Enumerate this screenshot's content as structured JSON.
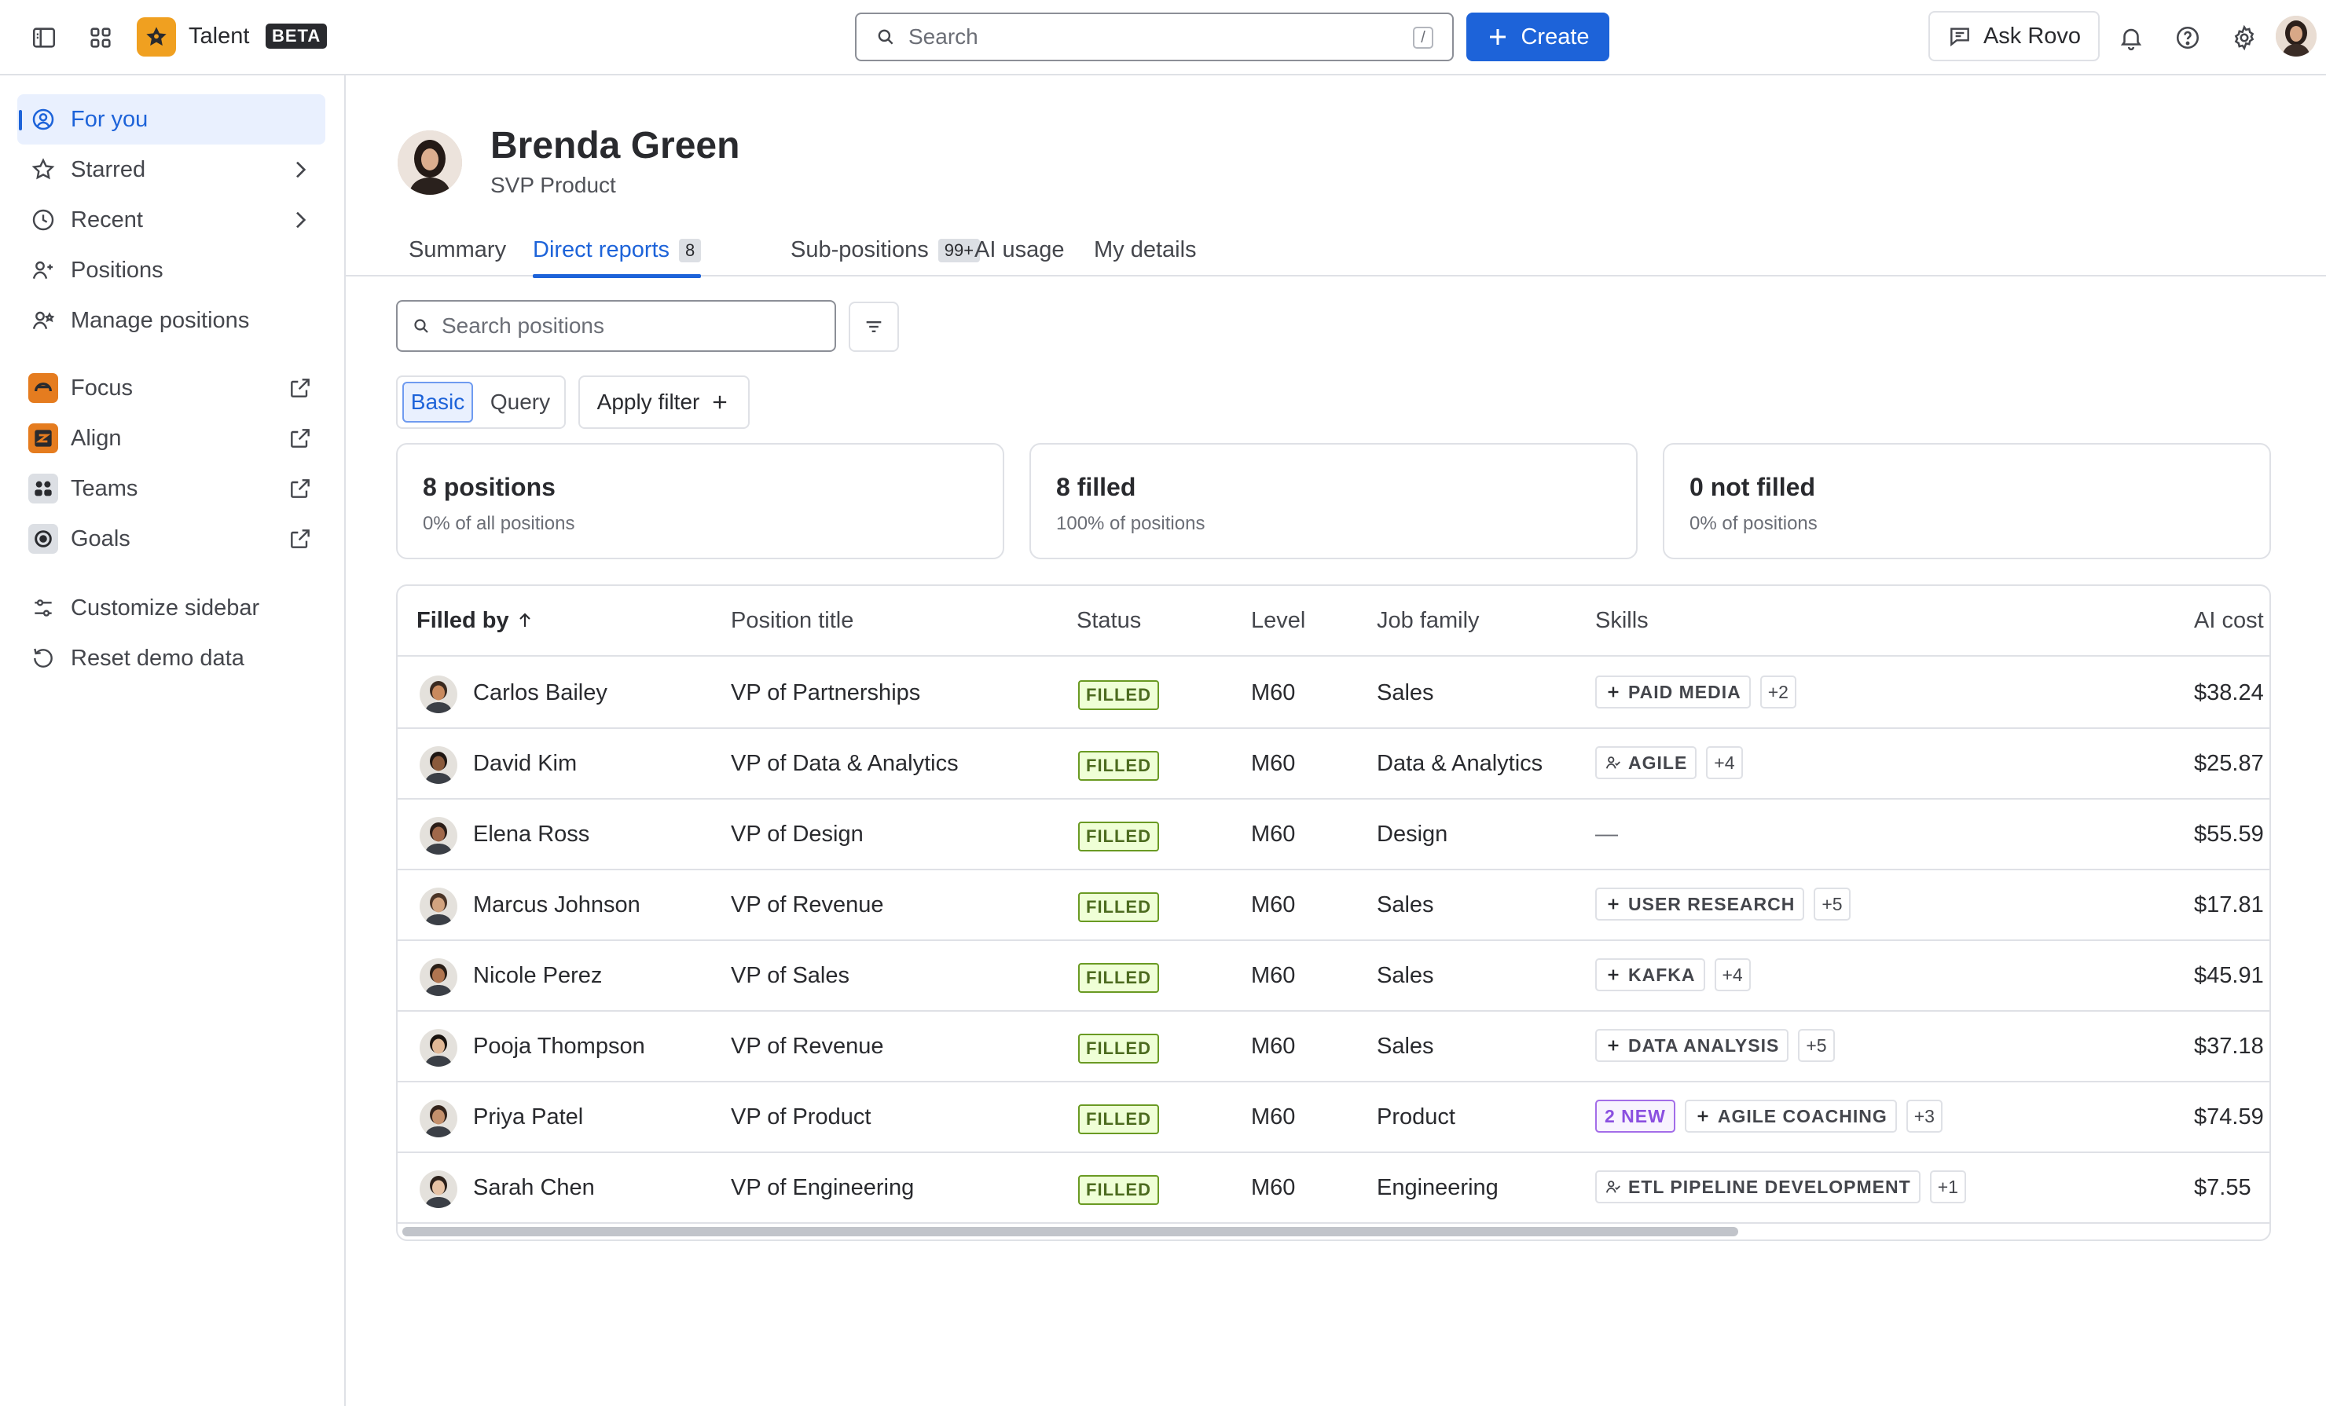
{
  "topbar": {
    "app_name": "Talent",
    "badge": "BETA",
    "search_placeholder": "Search",
    "search_shortcut": "/",
    "create_label": "Create",
    "ask_rovo_label": "Ask Rovo"
  },
  "sidebar": {
    "items": [
      {
        "label": "For you",
        "icon": "user-circle-icon",
        "active": true
      },
      {
        "label": "Starred",
        "icon": "star-icon"
      },
      {
        "label": "Recent",
        "icon": "clock-icon"
      },
      {
        "label": "Positions",
        "icon": "person-icon"
      },
      {
        "label": "Manage positions",
        "icon": "person-settings-icon"
      }
    ],
    "apps": [
      {
        "label": "Focus",
        "icon": "focus-icon",
        "color": "#e57c1f"
      },
      {
        "label": "Align",
        "icon": "align-icon",
        "color": "#e57c1f"
      },
      {
        "label": "Teams",
        "icon": "teams-icon",
        "color": "#dcdfe4"
      },
      {
        "label": "Goals",
        "icon": "goals-icon",
        "color": "#dcdfe4"
      }
    ],
    "footer": [
      {
        "label": "Customize sidebar",
        "icon": "customize-icon"
      },
      {
        "label": "Reset demo data",
        "icon": "reset-icon"
      }
    ]
  },
  "profile": {
    "name": "Brenda Green",
    "role": "SVP Product"
  },
  "tabs": [
    {
      "label": "Summary"
    },
    {
      "label": "Direct reports",
      "count": "8",
      "active": true
    },
    {
      "label": "Sub-positions",
      "count": "99+"
    },
    {
      "label": "AI usage"
    },
    {
      "label": "My details"
    }
  ],
  "filters": {
    "search_placeholder": "Search positions",
    "basic_label": "Basic",
    "query_label": "Query",
    "apply_filter_label": "Apply filter"
  },
  "stats": [
    {
      "value": "8 positions",
      "caption": "0% of all positions"
    },
    {
      "value": "8 filled",
      "caption": "100% of positions"
    },
    {
      "value": "0 not filled",
      "caption": "0% of positions"
    }
  ],
  "table": {
    "headers": {
      "filled_by": "Filled by",
      "position_title": "Position title",
      "status": "Status",
      "level": "Level",
      "job_family": "Job family",
      "skills": "Skills",
      "ai_cost": "AI cost"
    },
    "rows": [
      {
        "name": "Carlos Bailey",
        "title": "VP of Partnerships",
        "status": "FILLED",
        "level": "M60",
        "family": "Sales",
        "skill": "PAID MEDIA",
        "skill_icon": "plus",
        "more": "+2",
        "cost": "$38.24"
      },
      {
        "name": "David Kim",
        "title": "VP of Data & Analytics",
        "status": "FILLED",
        "level": "M60",
        "family": "Data & Analytics",
        "skill": "AGILE",
        "skill_icon": "person",
        "more": "+4",
        "cost": "$25.87"
      },
      {
        "name": "Elena Ross",
        "title": "VP of Design",
        "status": "FILLED",
        "level": "M60",
        "family": "Design",
        "skill": "",
        "empty": "—",
        "cost": "$55.59"
      },
      {
        "name": "Marcus Johnson",
        "title": "VP of Revenue",
        "status": "FILLED",
        "level": "M60",
        "family": "Sales",
        "skill": "USER RESEARCH",
        "skill_icon": "plus",
        "more": "+5",
        "cost": "$17.81"
      },
      {
        "name": "Nicole Perez",
        "title": "VP of Sales",
        "status": "FILLED",
        "level": "M60",
        "family": "Sales",
        "skill": "KAFKA",
        "skill_icon": "plus",
        "more": "+4",
        "cost": "$45.91"
      },
      {
        "name": "Pooja Thompson",
        "title": "VP of Revenue",
        "status": "FILLED",
        "level": "M60",
        "family": "Sales",
        "skill": "DATA ANALYSIS",
        "skill_icon": "plus",
        "more": "+5",
        "cost": "$37.18"
      },
      {
        "name": "Priya Patel",
        "title": "VP of Product",
        "status": "FILLED",
        "level": "M60",
        "family": "Product",
        "new_badge": "2 NEW",
        "skill": "AGILE COACHING",
        "skill_icon": "plus",
        "more": "+3",
        "cost": "$74.59"
      },
      {
        "name": "Sarah Chen",
        "title": "VP of Engineering",
        "status": "FILLED",
        "level": "M60",
        "family": "Engineering",
        "skill": "ETL PIPELINE DEVELOPMENT",
        "skill_icon": "person",
        "more": "+1",
        "cost": "$7.55"
      }
    ]
  }
}
